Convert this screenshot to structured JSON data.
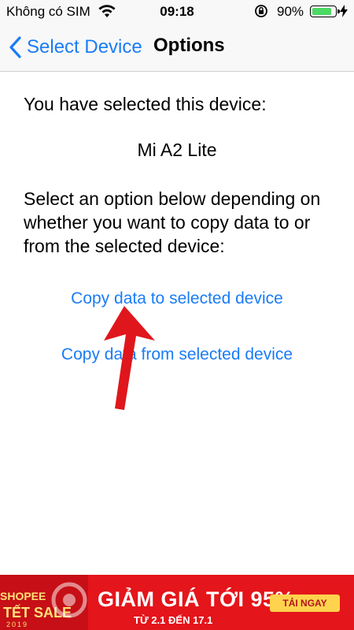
{
  "status": {
    "carrier": "Không có SIM",
    "time": "09:18",
    "battery_percent": "90%",
    "battery_level": 0.9
  },
  "nav": {
    "back_label": "Select Device",
    "title": "Options"
  },
  "content": {
    "selected_intro": "You have selected this device:",
    "device_name": "Mi A2 Lite",
    "instruction": "Select an option below depending on whether you want to copy data to or from the selected device:",
    "copy_to_label": "Copy data to selected device",
    "copy_from_label": "Copy data from selected device"
  },
  "banner": {
    "brand": "SHOPEE",
    "sale": "TẾT SALE",
    "year": "2019",
    "headline": "GIẢM GIÁ TỚI 95%",
    "dates": "TỪ 2.1 ĐẾN 17.1",
    "cta": "TẢI NGAY",
    "color_bg": "#e4151b"
  },
  "colors": {
    "link": "#1a7cf5",
    "arrow": "#e0161d",
    "battery_fill": "#4cd964"
  },
  "icons": [
    "wifi-icon",
    "rotation-lock-icon",
    "battery-icon",
    "charging-bolt-icon",
    "chevron-left-icon",
    "red-arrow-annotation"
  ]
}
